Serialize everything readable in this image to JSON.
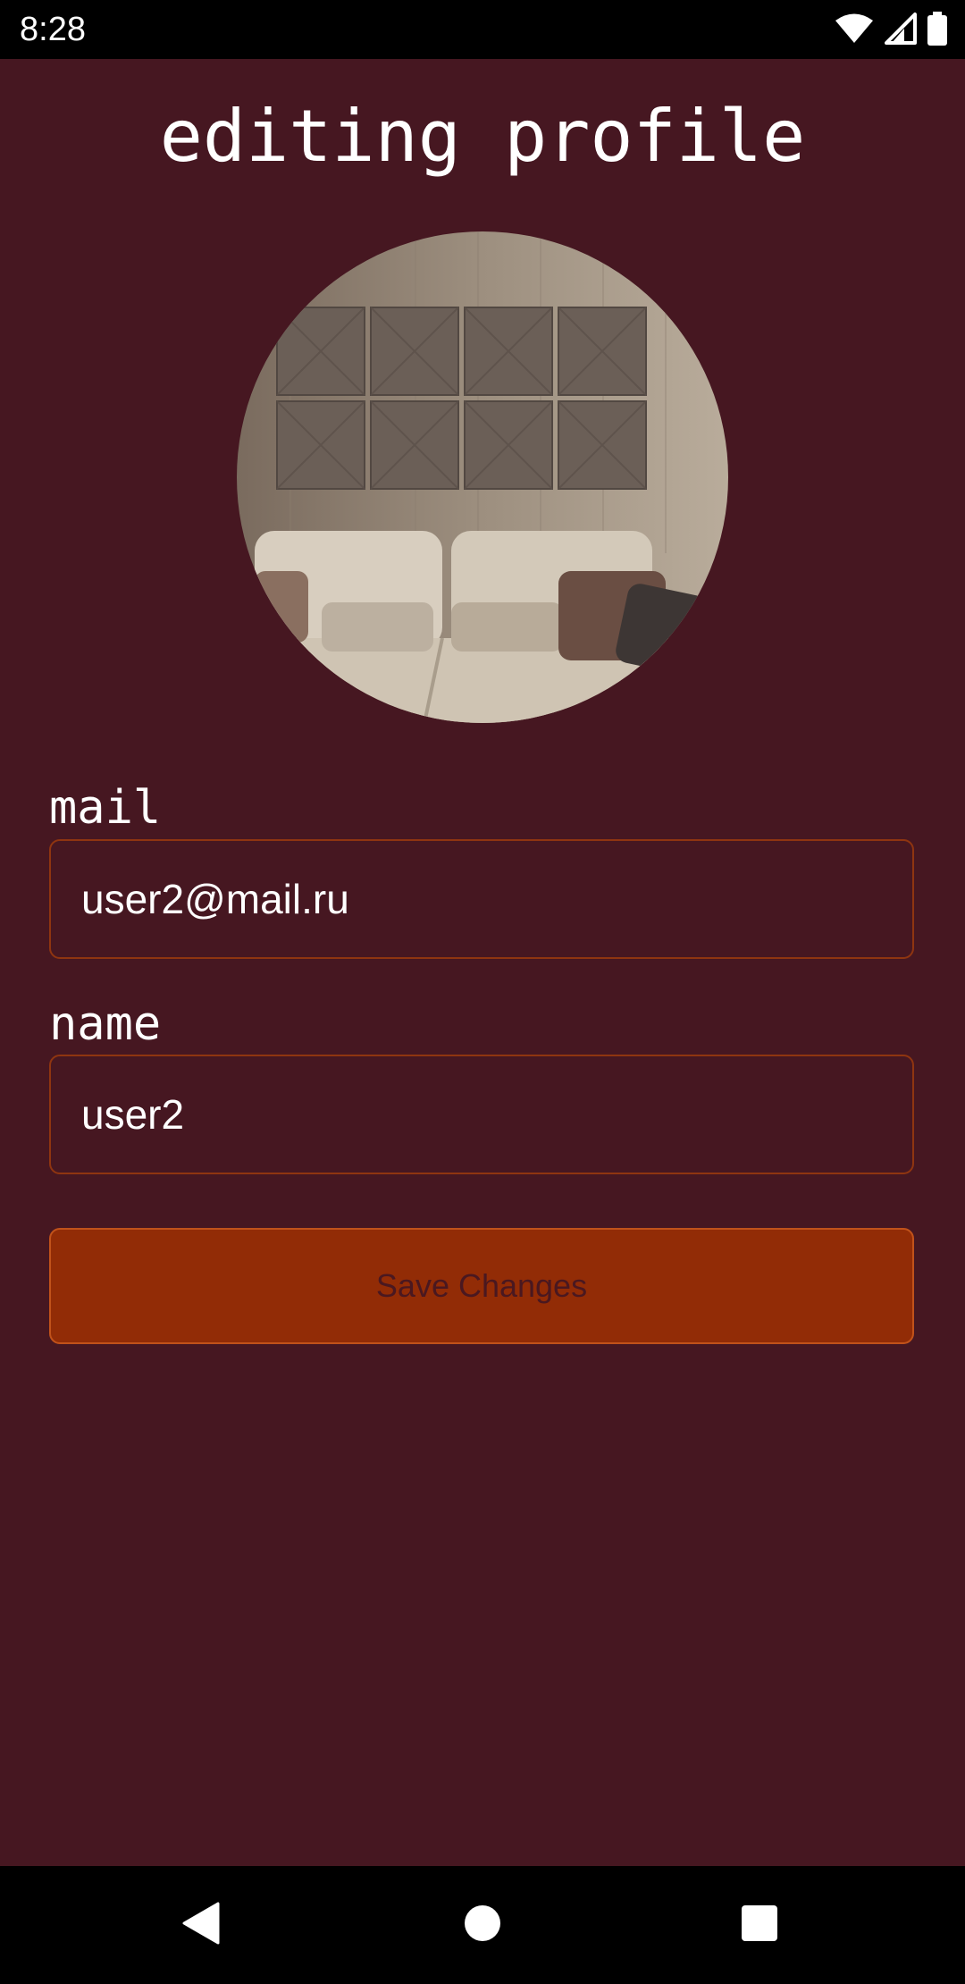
{
  "status_bar": {
    "time": "8:28",
    "icons": [
      "wifi-icon",
      "cellular-signal-icon",
      "battery-icon"
    ]
  },
  "page": {
    "title": "editing profile",
    "avatar": {
      "subject": "sofa in front of wall panels"
    }
  },
  "form": {
    "mail": {
      "label": "mail",
      "value": "user2@mail.ru"
    },
    "name": {
      "label": "name",
      "value": "user2"
    },
    "save_label": "Save Changes"
  },
  "nav_bar": {
    "icons": [
      "back-icon",
      "home-icon",
      "recents-icon"
    ]
  },
  "colors": {
    "background": "#461721",
    "field_border": "#8f3510",
    "button_fill": "#922c06",
    "button_text": "#4a1820",
    "text": "#ffffff"
  }
}
